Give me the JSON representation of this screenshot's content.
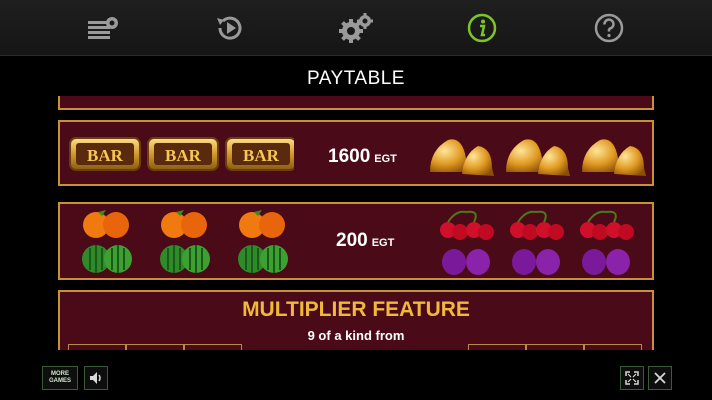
{
  "nav": {
    "items": [
      {
        "name": "menu-settings",
        "icon": "stack-gear-icon"
      },
      {
        "name": "autoplay",
        "icon": "replay-play-icon"
      },
      {
        "name": "settings",
        "icon": "gears-icon"
      },
      {
        "name": "info",
        "icon": "info-icon",
        "active": true,
        "color": "#7cc427"
      },
      {
        "name": "help",
        "icon": "question-icon"
      }
    ]
  },
  "page": {
    "title": "PAYTABLE"
  },
  "paytable": {
    "row1": {
      "value": "1600",
      "unit": "EGT",
      "left_symbol": "bar",
      "right_symbol": "bells"
    },
    "row2": {
      "value": "200",
      "unit": "EGT",
      "left_symbol": "orange-watermelon",
      "right_symbol": "cherry-plum"
    }
  },
  "multiplier": {
    "title": "MULTIPLIER FEATURE",
    "subtitle": "9 of a kind from"
  },
  "bottom": {
    "more_games_line1": "MORE",
    "more_games_line2": "GAMES"
  },
  "colors": {
    "panel": "#4a0a18",
    "border": "#c9903a",
    "gold": "#f0b93a",
    "active": "#7cc427"
  }
}
